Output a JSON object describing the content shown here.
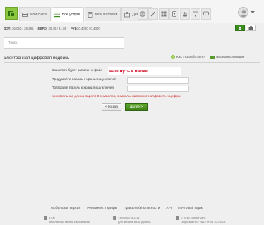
{
  "nav": {
    "tabs": [
      {
        "label": "Мои счета",
        "active": false
      },
      {
        "label": "Все услуги",
        "active": true
      },
      {
        "label": "Мои платежи",
        "active": false
      },
      {
        "label": "Депозиты",
        "active": false
      }
    ],
    "icon_tabs": [
      "globe-icon",
      "tools-icon",
      "grid-icon",
      "badge-icon",
      "people-icon",
      "monitor-icon",
      "chat-icon"
    ]
  },
  "rates": [
    {
      "currency": "ДОЛ:",
      "value": "26.050 / 26.395"
    },
    {
      "currency": "ЕВРО:",
      "value": "30.40 / 31.05"
    },
    {
      "currency": "РУБ:",
      "value": "0.4000 / 0.4300"
    }
  ],
  "search": {
    "placeholder": "Поиск"
  },
  "page": {
    "title": "Электронная цифровая подпись",
    "help_link": "Как это работает?",
    "video_link": "Видеоинструкция"
  },
  "form": {
    "key_saved_label": "Ваш ключ будет записан в файл",
    "key_path": "ваш путь к папке",
    "password_label": "Придумайте пароль к хранилищу ключей",
    "repeat_label": "Повторите пароль к хранилищу ключей",
    "warning": "Минимальная длина пароля 8 символов, символы латинского алфавита и цифры",
    "back_label": "< Назад",
    "next_label": "Далее >"
  },
  "footer": {
    "links": [
      "Мобильная версия",
      "Регламент/Тарифы",
      "Правила безопасности",
      "API",
      "Почтовый ящик"
    ],
    "phone_short": "3700",
    "phone_short_note": "бесплатный звонок с мобильных",
    "phone_full": "+38(056)7161131",
    "phone_full_note": "для звонков из-за рубежа",
    "copyright": "© 2014 ПриватБанк",
    "license": "Лицензия НБУ №22 от 05.10.2011 г."
  },
  "colors": {
    "brand_green": "#3a8a1e",
    "warning_red": "#cc2a2a",
    "path_red": "#d0021b"
  }
}
